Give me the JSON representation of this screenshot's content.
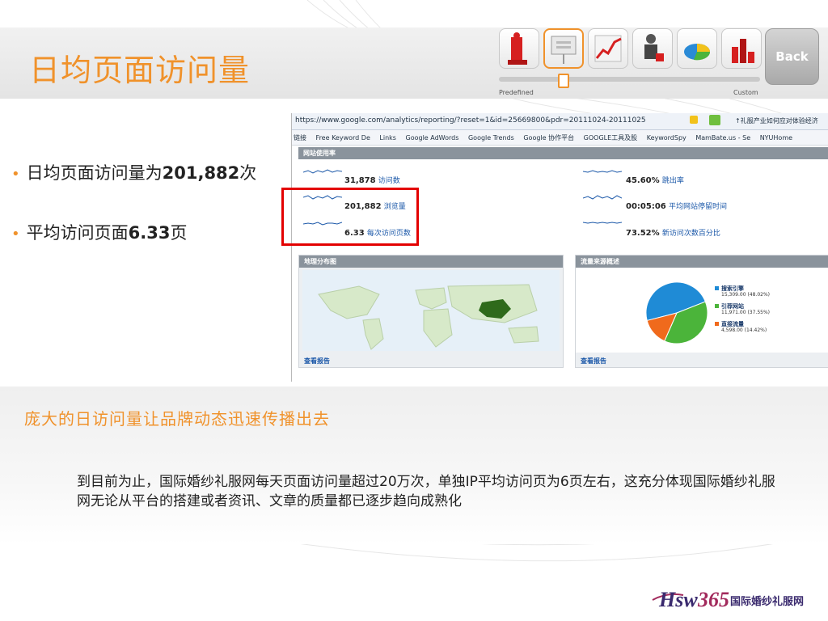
{
  "slide": {
    "title": "日均页面访问量",
    "bullets": [
      {
        "text": "日均页面访问量为",
        "bold": "201,882",
        "suffix": "次"
      },
      {
        "text": "平均访问页面",
        "bold": "6.33",
        "suffix": "页"
      }
    ],
    "headline": "庞大的日访问量让品牌动态迅速传播出去",
    "body": "到目前为止，国际婚纱礼服网每天页面访问量超过20万次，单独IP平均访问页为6页左右，这充分体现国际婚纱礼服网无论从平台的搭建或者资讯、文章的质量都已逐步趋向成熟化"
  },
  "nav": {
    "back_label": "Back",
    "predefined_label": "Predefined",
    "custom_label": "Custom",
    "thumbnails": [
      "podium-icon",
      "presentation-icon",
      "line-chart-icon",
      "business-person-icon",
      "pie-chart-3d-icon",
      "ranking-icon"
    ],
    "active_index": 1,
    "slider_position": 0.25
  },
  "browser": {
    "url": "https://www.google.com/analytics/reporting/?reset=1&id=25669800&pdr=20111024-20111025",
    "tab_title": "↑礼服产业如何应对体验经济",
    "bookmarks": [
      "链接",
      "Free Keyword De",
      "Links",
      "Google AdWords",
      "Google Trends",
      "Google 协作平台",
      "GOOGLE工具及股",
      "KeywordSpy",
      "MamBate.us - Se",
      "NYUHome"
    ],
    "usage_title": "网站使用率",
    "metrics_left": [
      {
        "value": "31,878",
        "label": "访问数"
      },
      {
        "value": "201,882",
        "label": "浏览量"
      },
      {
        "value": "6.33",
        "label": "每次访问页数"
      }
    ],
    "metrics_right": [
      {
        "value": "45.60%",
        "label": "跳出率"
      },
      {
        "value": "00:05:06",
        "label": "平均网站停留时间"
      },
      {
        "value": "73.52%",
        "label": "新访问次数百分比"
      }
    ],
    "geo_title": "地理分布图",
    "traffic_title": "流量来源概述",
    "view_report": "查看报告"
  },
  "chart_data": {
    "type": "pie",
    "title": "流量来源概述",
    "slices": [
      {
        "name": "搜索引擎",
        "value": 15309.0,
        "percent": 48.02,
        "detail": "15,309.00 (48.02%)",
        "color": "#1f8bd6"
      },
      {
        "name": "引荐网站",
        "value": 11971.0,
        "percent": 37.55,
        "detail": "11,971.00 (37.55%)",
        "color": "#4bb43a"
      },
      {
        "name": "直接流量",
        "value": 4598.0,
        "percent": 14.42,
        "detail": "4,598.00 (14.42%)",
        "color": "#f06a1c"
      }
    ],
    "legend": "right"
  },
  "logo": {
    "brand": "Hsw365",
    "name": "国际婚纱礼服网",
    "sub": ".com"
  },
  "colors": {
    "accent": "#f0922b",
    "highlight_box": "#e30000",
    "link": "#1a57a8"
  }
}
